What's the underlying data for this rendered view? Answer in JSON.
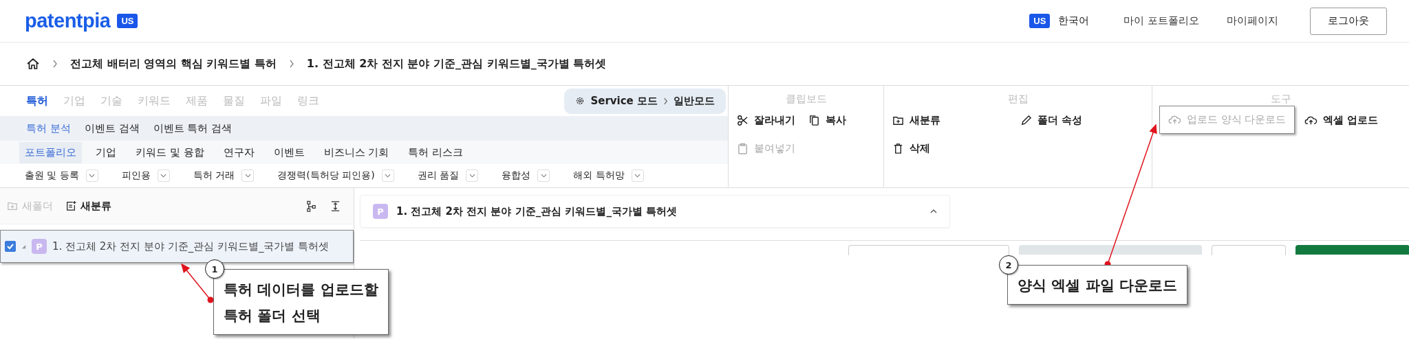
{
  "header": {
    "logo": "patentpia",
    "region_badge": "US",
    "language_badge": "US",
    "language": "한국어",
    "links": [
      "마이 포트폴리오",
      "마이페이지"
    ],
    "logout": "로그아웃"
  },
  "breadcrumb": [
    "전고체 배터리 영역의 핵심 키워드별 특허",
    "1. 전고체 2차 전지 분야 기준_관심 키워드별_국가별 특허셋"
  ],
  "main_tabs": [
    {
      "label": "특허",
      "selected": true
    },
    {
      "label": "기업",
      "selected": false
    },
    {
      "label": "기술",
      "selected": false
    },
    {
      "label": "키워드",
      "selected": false
    },
    {
      "label": "제품",
      "selected": false
    },
    {
      "label": "물질",
      "selected": false
    },
    {
      "label": "파일",
      "selected": false
    },
    {
      "label": "링크",
      "selected": false
    }
  ],
  "mode": {
    "service": "Service 모드",
    "current": "일반모드"
  },
  "sub_tabs": [
    {
      "label": "특허 분석",
      "selected": true
    },
    {
      "label": "이벤트 검색",
      "selected": false
    },
    {
      "label": "이벤트 특허 검색",
      "selected": false
    }
  ],
  "portfolio_tabs": [
    {
      "label": "포트폴리오",
      "selected": true
    },
    {
      "label": "기업",
      "selected": false
    },
    {
      "label": "키워드 및 융합",
      "selected": false
    },
    {
      "label": "연구자",
      "selected": false
    },
    {
      "label": "이벤트",
      "selected": false
    },
    {
      "label": "비즈니스 기회",
      "selected": false
    },
    {
      "label": "특허 리스크",
      "selected": false
    }
  ],
  "filters": [
    "출원 및 등록",
    "피인용",
    "특허 거래",
    "경쟁력(특허당 피인용)",
    "권리 품질",
    "융합성",
    "해외 특허망"
  ],
  "ribbon": [
    {
      "title": "클립보드",
      "tools": [
        {
          "label": "잘라내기",
          "disabled": false,
          "highlighted": false
        },
        {
          "label": "복사",
          "disabled": false,
          "highlighted": false
        },
        {
          "label": "붙여넣기",
          "disabled": true,
          "highlighted": false
        }
      ]
    },
    {
      "title": "편집",
      "tools": [
        {
          "label": "새분류",
          "disabled": false,
          "highlighted": false
        },
        {
          "label": "폴더 속성",
          "disabled": false,
          "highlighted": false
        },
        {
          "label": "삭제",
          "disabled": false,
          "highlighted": false
        }
      ]
    },
    {
      "title": "도구",
      "tools": [
        {
          "label": "업로드 양식 다운로드",
          "disabled": true,
          "highlighted": true
        },
        {
          "label": "엑셀 업로드",
          "disabled": false,
          "highlighted": false
        }
      ]
    }
  ],
  "tree_toolbar": [
    {
      "label": "새폴더",
      "disabled": true
    },
    {
      "label": "새분류",
      "disabled": false
    }
  ],
  "tree": [
    {
      "badge": "P",
      "label": "1. 전고체 2차 전지 분야 기준_관심 키워드별_국가별 특허셋",
      "checked": true,
      "highlighted": true
    }
  ],
  "panel": {
    "badge": "P",
    "title": "1. 전고체 2차 전지 분야 기준_관심 키워드별_국가별 특허셋"
  },
  "annotations": [
    {
      "number": "1",
      "lines": [
        "특허 데이터를 업로드할",
        "특허 폴더 선택"
      ]
    },
    {
      "number": "2",
      "lines": [
        "양식 엑셀 파일 다운로드"
      ]
    }
  ]
}
